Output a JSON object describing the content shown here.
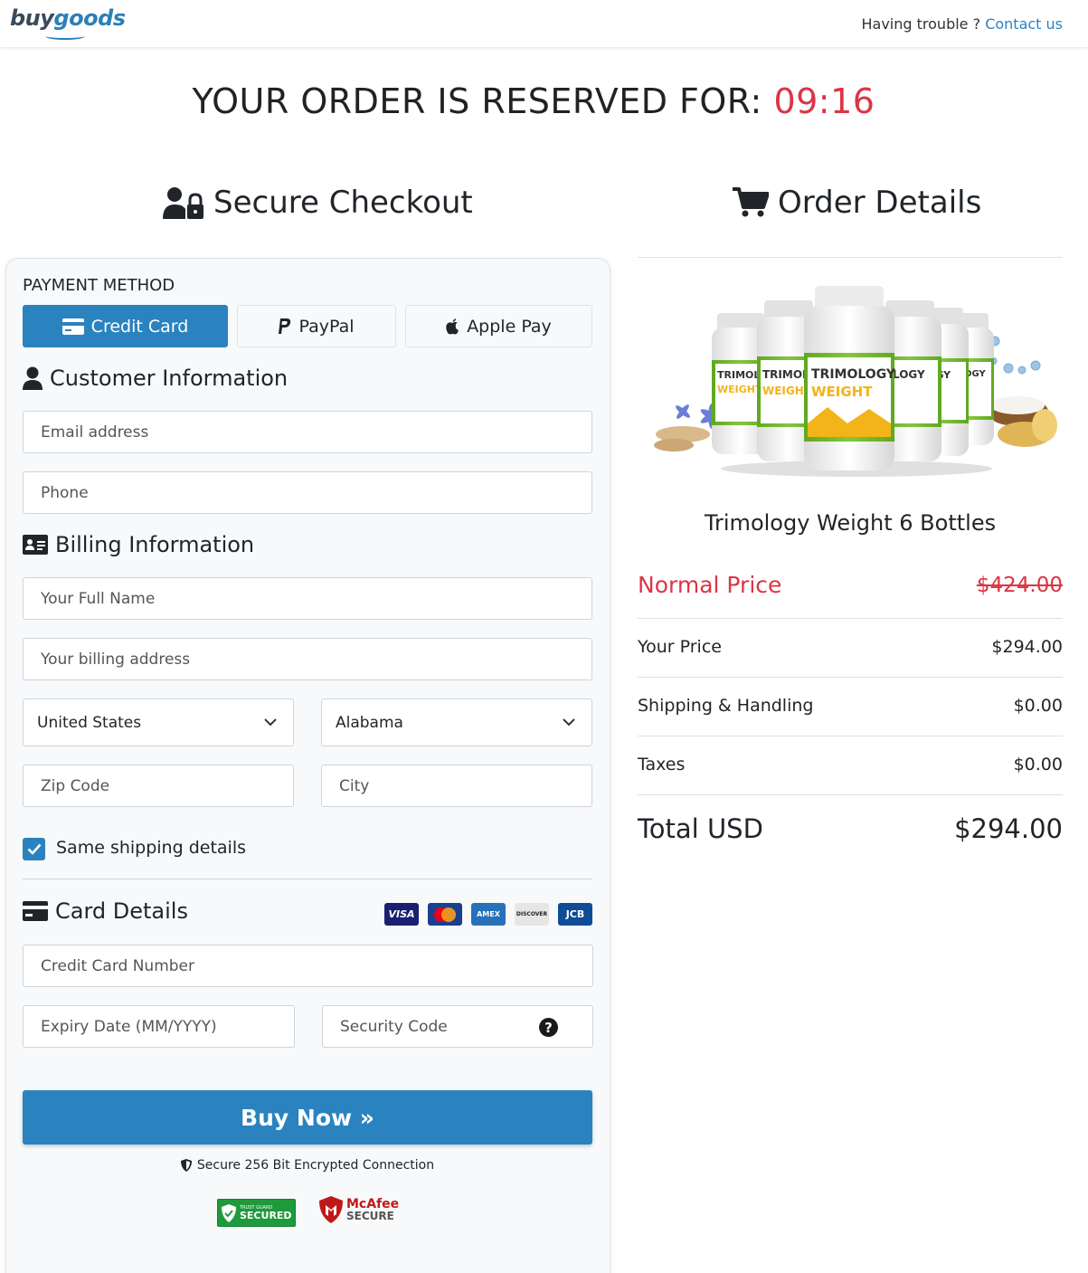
{
  "header": {
    "logo_part1": "buy",
    "logo_part2": "goods",
    "trouble_text": "Having trouble ?",
    "contact_link": "Contact us"
  },
  "reservation": {
    "text": "YOUR ORDER IS RESERVED FOR:",
    "timer": "09:16"
  },
  "checkout": {
    "title": "Secure Checkout",
    "payment_method_label": "PAYMENT METHOD",
    "payment_methods": [
      "Credit Card",
      "PayPal",
      "Apple Pay"
    ],
    "customer_title": "Customer Information",
    "email_placeholder": "Email address",
    "phone_placeholder": "Phone",
    "billing_title": "Billing Information",
    "fullname_placeholder": "Your Full Name",
    "address_placeholder": "Your billing address",
    "country_value": "United States",
    "state_value": "Alabama",
    "zip_placeholder": "Zip Code",
    "city_placeholder": "City",
    "same_shipping_label": "Same shipping details",
    "same_shipping_checked": true,
    "card_title": "Card Details",
    "card_brands": [
      "VISA",
      "Mastercard",
      "AMEX",
      "DISCOVER",
      "JCB"
    ],
    "card_number_placeholder": "Credit Card Number",
    "expiry_placeholder": "Expiry Date (MM/YYYY)",
    "security_placeholder": "Security Code",
    "buy_label": "Buy Now »",
    "secure_note": "Secure 256 Bit Encrypted Connection",
    "trust_badge_small": "TRUST GUARD",
    "trust_badge_main": "SECURED",
    "mcafee_line1": "McAfee",
    "mcafee_line2": "SECURE"
  },
  "order": {
    "title": "Order Details",
    "product_name": "Trimology Weight 6 Bottles",
    "bottle_brand": "TRIMOLOGY",
    "bottle_product": "WEIGHT",
    "normal_price_label": "Normal Price",
    "normal_price": "$424.00",
    "your_price_label": "Your Price",
    "your_price": "$294.00",
    "shipping_label": "Shipping & Handling",
    "shipping": "$0.00",
    "taxes_label": "Taxes",
    "taxes": "$0.00",
    "total_label": "Total USD",
    "total": "$294.00"
  },
  "colors": {
    "accent": "#2a83bf",
    "danger": "#dc3545",
    "panel": "#f8f9fa"
  }
}
